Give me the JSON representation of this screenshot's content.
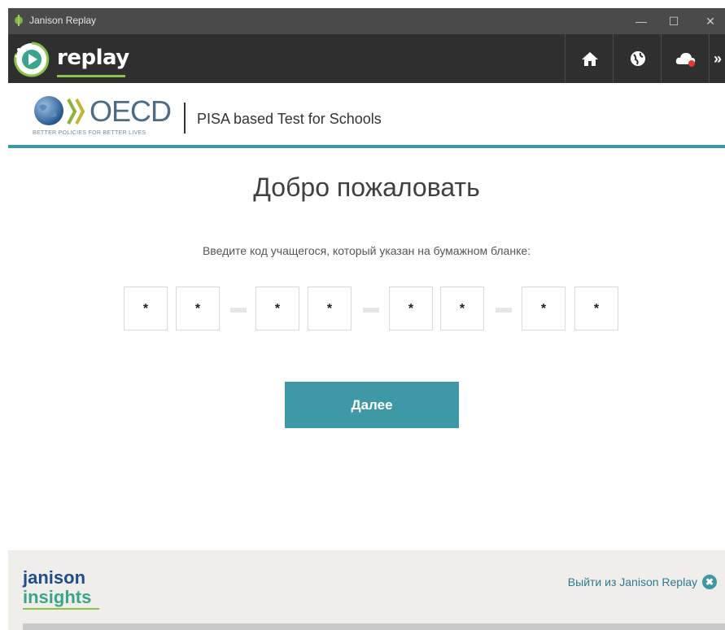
{
  "window": {
    "title": "Janison Replay",
    "minimize_glyph": "—",
    "maximize_glyph": "☐",
    "close_glyph": "✕"
  },
  "toolbar": {
    "brand": "replay",
    "buttons": [
      {
        "icon": "home-icon"
      },
      {
        "icon": "globe-icon"
      },
      {
        "icon": "cloud-status-icon"
      },
      {
        "icon": "expand-chevron-icon",
        "glyph": "»"
      }
    ]
  },
  "header": {
    "org_name": "OECD",
    "org_tagline": "BETTER POLICIES FOR BETTER LIVES",
    "subtitle": "PISA based Test for Schools"
  },
  "main": {
    "welcome": "Добро пожаловать",
    "instruction": "Введите код учащегося, который указан на бумажном бланке:",
    "code_values": [
      "*",
      "*",
      "*",
      "*",
      "*",
      "*",
      "*",
      "*"
    ],
    "next_label": "Далее"
  },
  "footer": {
    "logo_line1": "janison",
    "logo_line2": "insights",
    "exit_label": "Выйти из Janison Replay",
    "exit_glyph": "✖"
  },
  "colors": {
    "accent": "#3e98a5",
    "titlebar": "#4a4a4a",
    "toolbar": "#2f2f2f",
    "footer": "#efeeeb",
    "brand_green": "#8bc34a"
  }
}
